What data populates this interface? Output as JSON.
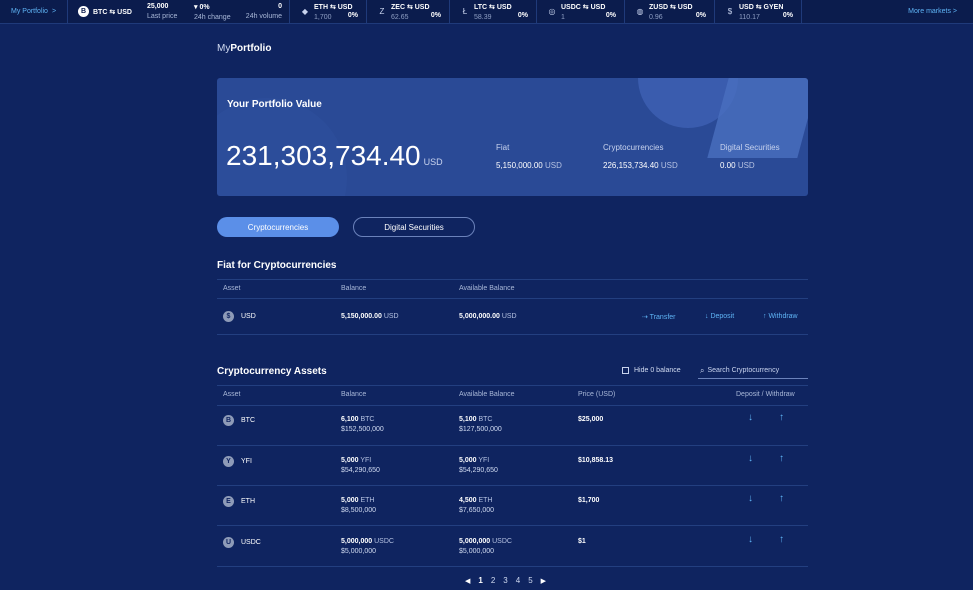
{
  "ticker": {
    "portfolio_label": "My Portfolio",
    "portfolio_arrow": ">",
    "main": {
      "icon_letter": "B",
      "pair": "BTC ⇆ USD",
      "last_price_value": "25,000",
      "last_price_label": "Last price",
      "change_value": "▾ 0%",
      "change_label": "24h change",
      "volume_value": "0",
      "volume_label": "24h volume"
    },
    "items": [
      {
        "icon": "◆",
        "pair": "ETH ⇆ USD",
        "price": "1,700",
        "change": "0%"
      },
      {
        "icon": "Z",
        "pair": "ZEC ⇆ USD",
        "price": "62.65",
        "change": "0%"
      },
      {
        "icon": "Ł",
        "pair": "LTC ⇆ USD",
        "price": "58.39",
        "change": "0%"
      },
      {
        "icon": "◎",
        "pair": "USDC ⇆ USD",
        "price": "1",
        "change": "0%"
      },
      {
        "icon": "◍",
        "pair": "ZUSD ⇆ USD",
        "price": "0.96",
        "change": "0%"
      },
      {
        "icon": "$",
        "pair": "USD ⇆ GYEN",
        "price": "110.17",
        "change": "0%"
      }
    ],
    "more_label": "More markets >"
  },
  "page": {
    "title_prefix": "My",
    "title_main": "Portfolio"
  },
  "summary": {
    "title": "Your Portfolio Value",
    "total": "231,303,734.40",
    "currency": "USD",
    "fiat_label": "Fiat",
    "fiat_value": "5,150,000.00",
    "fiat_unit": "USD",
    "crypto_label": "Cryptocurrencies",
    "crypto_value": "226,153,734.40",
    "crypto_unit": "USD",
    "securities_label": "Digital Securities",
    "securities_value": "0.00",
    "securities_unit": "USD"
  },
  "tabs": {
    "crypto": "Cryptocurrencies",
    "securities": "Digital Securities"
  },
  "fiat_section": {
    "title": "Fiat for Cryptocurrencies",
    "headers": {
      "asset": "Asset",
      "balance": "Balance",
      "available": "Available Balance"
    },
    "row": {
      "icon": "$",
      "name": "USD",
      "balance": "5,150,000.00",
      "balance_unit": "USD",
      "available": "5,000,000.00",
      "available_unit": "USD",
      "transfer": "⇢ Transfer",
      "deposit": "↓ Deposit",
      "withdraw": "↑ Withdraw"
    }
  },
  "crypto_section": {
    "title": "Cryptocurrency Assets",
    "hide_zero": "Hide 0 balance",
    "search_placeholder": "Search Cryptocurrency",
    "headers": {
      "asset": "Asset",
      "balance": "Balance",
      "available": "Available Balance",
      "price": "Price (USD)",
      "action": "Deposit / Withdraw"
    },
    "rows": [
      {
        "icon": "B",
        "name": "BTC",
        "balance": "6,100",
        "unit": "BTC",
        "balance_usd": "$152,500,000",
        "available": "5,100",
        "available_usd": "$127,500,000",
        "price": "$25,000"
      },
      {
        "icon": "Y",
        "name": "YFI",
        "balance": "5,000",
        "unit": "YFI",
        "balance_usd": "$54,290,650",
        "available": "5,000",
        "available_usd": "$54,290,650",
        "price": "$10,858.13"
      },
      {
        "icon": "E",
        "name": "ETH",
        "balance": "5,000",
        "unit": "ETH",
        "balance_usd": "$8,500,000",
        "available": "4,500",
        "available_usd": "$7,650,000",
        "price": "$1,700"
      },
      {
        "icon": "U",
        "name": "USDC",
        "balance": "5,000,000",
        "unit": "USDC",
        "balance_usd": "$5,000,000",
        "available": "5,000,000",
        "available_usd": "$5,000,000",
        "price": "$1"
      }
    ],
    "deposit_arrow": "↓",
    "withdraw_arrow": "↑"
  },
  "pagination": {
    "prev": "◀",
    "pages": [
      "1",
      "2",
      "3",
      "4",
      "5"
    ],
    "next": "▶"
  }
}
